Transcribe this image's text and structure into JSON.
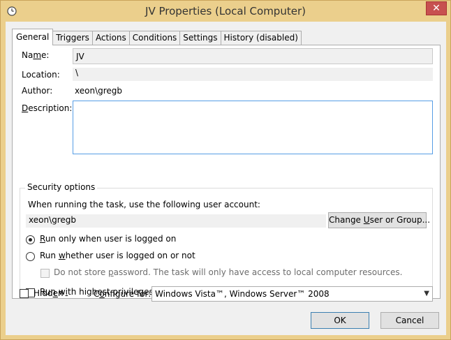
{
  "window": {
    "title": "JV Properties (Local Computer)",
    "close_glyph": "✕",
    "icon": "clock-icon"
  },
  "tabs": [
    {
      "label": "General",
      "active": true
    },
    {
      "label": "Triggers"
    },
    {
      "label": "Actions"
    },
    {
      "label": "Conditions"
    },
    {
      "label": "Settings"
    },
    {
      "label": "History (disabled)"
    }
  ],
  "general": {
    "name_label_pre": "Na",
    "name_label_u": "m",
    "name_label_post": "e:",
    "name_value": "JV",
    "location_label": "Location:",
    "location_value": "\\",
    "author_label": "Author:",
    "author_value": "xeon\\gregb",
    "description_label_u": "D",
    "description_label_post": "escription:",
    "description_value": ""
  },
  "security": {
    "title": "Security options",
    "account_prompt": "When running the task, use the following user account:",
    "account_value": "xeon\\gregb",
    "change_btn_pre": "Change ",
    "change_btn_u": "U",
    "change_btn_post": "ser or Group...",
    "run_logged_on_u": "R",
    "run_logged_on_post": "un only when user is logged on",
    "run_whether_pre": "Run ",
    "run_whether_u": "w",
    "run_whether_post": "hether user is logged on or not",
    "no_store_pre": "Do not store ",
    "no_store_u": "p",
    "no_store_post": "assword.  The task will only have access to local computer resources.",
    "highest_pre": "Run w",
    "highest_u": "i",
    "highest_post": "th highest privileges"
  },
  "footer": {
    "hidden_pre": "Hidd",
    "hidden_u": "e",
    "hidden_post": "n",
    "configure_pre": "C",
    "configure_u": "o",
    "configure_post": "nfigure for:",
    "configure_value": "Windows Vista™, Windows Server™ 2008",
    "ok_label": "OK",
    "cancel_label": "Cancel"
  },
  "colors": {
    "frame": "#ebcf8c",
    "close": "#c75050",
    "focus_border": "#569de5"
  }
}
